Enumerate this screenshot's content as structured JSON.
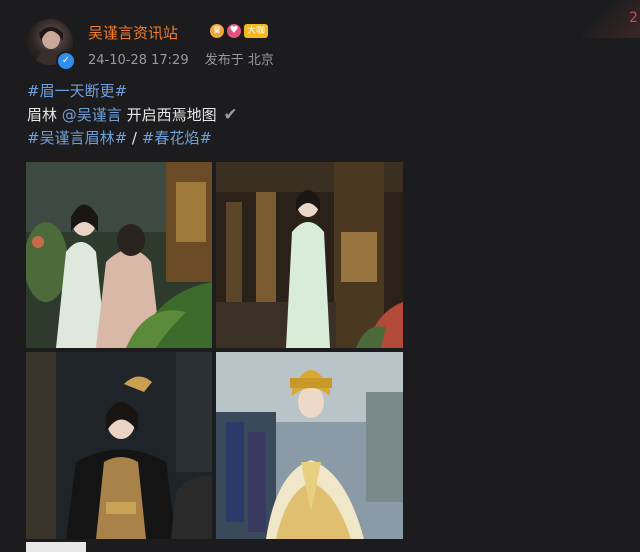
{
  "post": {
    "username": "吴谨言资讯站",
    "level_badge": "大咖",
    "timestamp": "24-10-28 17:29",
    "location": "发布于 北京",
    "corner_deco": "2"
  },
  "content": {
    "line1_tag": "#眉一天断更#",
    "line2_prefix": "眉林",
    "line2_mention": "@吴谨言",
    "line2_suffix": " 开启西焉地图 ",
    "line2_check": "✔",
    "line3_tag1": "#吴谨言眉林#",
    "line3_sep": " /",
    "line3_tag2": "#春花焰#"
  },
  "images": [
    {
      "desc": "woman in pale green hanfu with braids in garden"
    },
    {
      "desc": "woman in pale green robe standing by wooden pavilion"
    },
    {
      "desc": "woman in black and gold costume with headdress"
    },
    {
      "desc": "woman in gold embroidered robe with golden crown"
    }
  ]
}
